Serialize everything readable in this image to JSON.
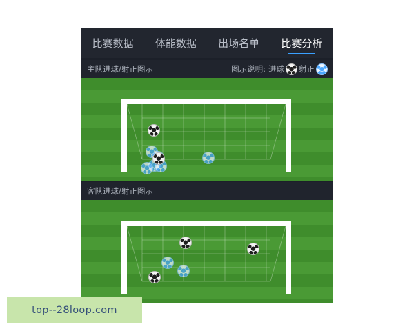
{
  "tabs": [
    {
      "label": "比赛数据"
    },
    {
      "label": "体能数据"
    },
    {
      "label": "出场名单"
    },
    {
      "label": "比赛分析",
      "active": true
    }
  ],
  "home_section": {
    "title": "主队进球/射正图示",
    "legend": {
      "prefix": "图示说明:",
      "goal_label": "进球",
      "shot_label": "射正"
    }
  },
  "away_section": {
    "title": "客队进球/射正图示"
  },
  "colors": {
    "panel_bg": "#1c2029",
    "pitch_dark": "#3f8d2c",
    "pitch_light": "#4a9a35",
    "active_tab_underline": "#3aa0ff",
    "watermark_bg": "#c8e5ab"
  },
  "icons": {
    "goal": "soccer-ball-icon",
    "shot_on_target": "soccer-ball-blue-icon"
  },
  "watermark": {
    "text": "top--28loop.com"
  }
}
